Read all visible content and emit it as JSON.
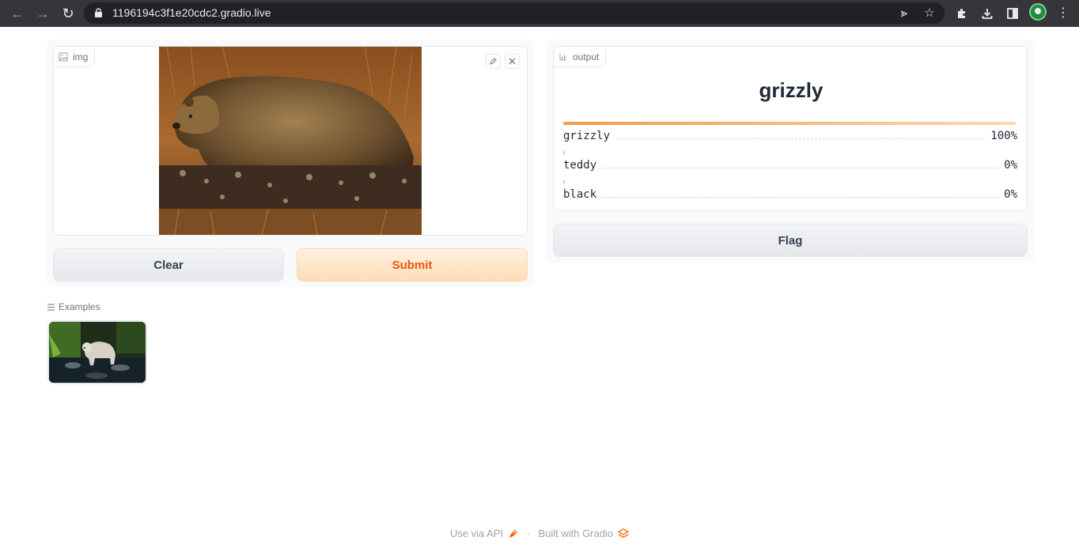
{
  "browser": {
    "url": "1196194c3f1e20cdc2.gradio.live"
  },
  "input": {
    "label": "img"
  },
  "buttons": {
    "clear": "Clear",
    "submit": "Submit",
    "flag": "Flag"
  },
  "output": {
    "label": "output",
    "top_label": "grizzly",
    "confidences": [
      {
        "label": "grizzly",
        "value": "100%",
        "fraction": 1.0
      },
      {
        "label": "teddy",
        "value": "0%",
        "fraction": 0.0
      },
      {
        "label": "black",
        "value": "0%",
        "fraction": 0.0
      }
    ]
  },
  "examples": {
    "header": "Examples"
  },
  "footer": {
    "api_link": "Use via API",
    "separator": "·",
    "built_with": "Built with Gradio"
  },
  "colors": {
    "accent": "#ea580c",
    "bar_start": "#f29a47",
    "bar_end": "#fcd9b0"
  }
}
